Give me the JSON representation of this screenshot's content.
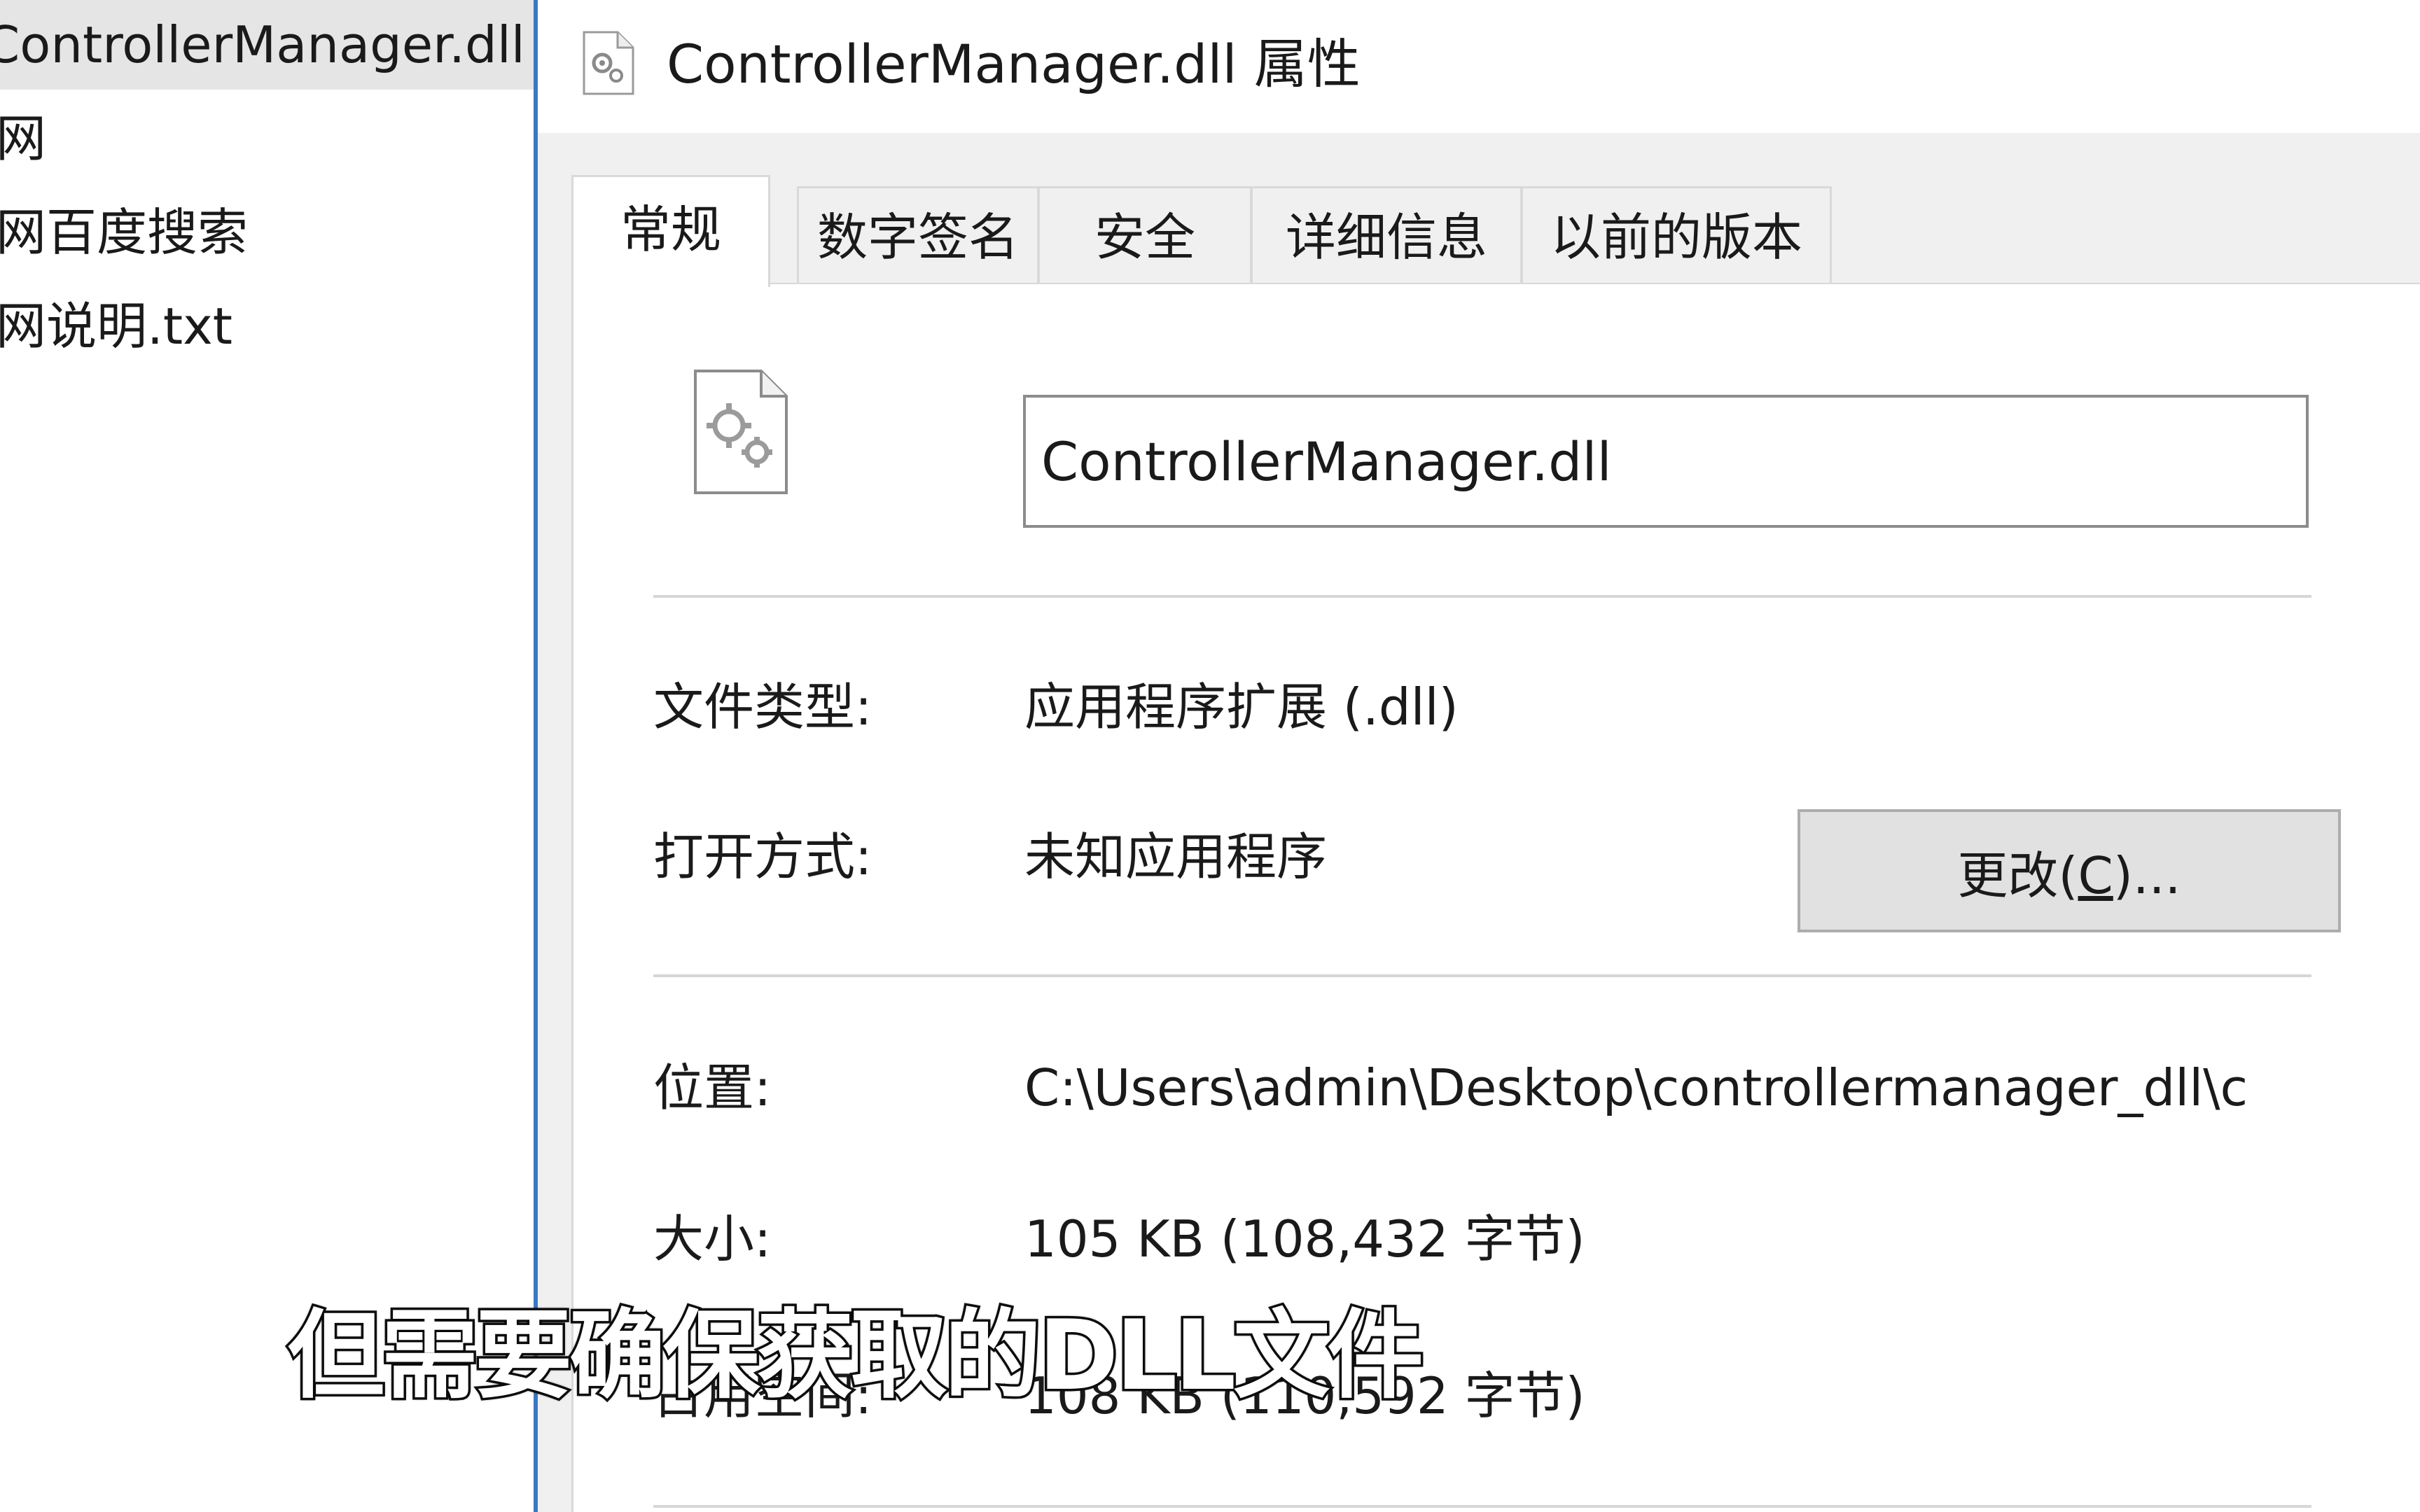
{
  "explorer": {
    "items": [
      {
        "label": "ControllerManager.dll",
        "selected": true
      },
      {
        "label": "网",
        "selected": false
      },
      {
        "label": "网百度搜索",
        "selected": false
      },
      {
        "label": "网说明.txt",
        "selected": false
      }
    ]
  },
  "dialog": {
    "title": "ControllerManager.dll 属性",
    "tabs": [
      "常规",
      "数字签名",
      "安全",
      "详细信息",
      "以前的版本"
    ],
    "active_tab": "常规",
    "file_name": "ControllerManager.dll",
    "props": {
      "file_type_label": "文件类型:",
      "file_type_value": "应用程序扩展 (.dll)",
      "open_with_label": "打开方式:",
      "open_with_value": "未知应用程序",
      "change_button_text": "更改",
      "change_button_mnemonic": "C",
      "change_button_open": "(",
      "change_button_close": ")...",
      "location_label": "位置:",
      "location_value": "C:\\Users\\admin\\Desktop\\controllermanager_dll\\c",
      "size_label": "大小:",
      "size_value": "105 KB (108,432 字节)",
      "size_on_disk_label": "占用空间:",
      "size_on_disk_value": "108 KB (110,592 字节)"
    }
  },
  "subtitle": "但需要确保获取的DLL文件",
  "icons": {
    "title_icon": "dll-file-icon",
    "file_icon": "dll-gear-file-icon"
  },
  "colors": {
    "split_accent": "#3b78c4",
    "selected_row": "#e5e5e5",
    "dialog_bg": "#f0f0f0"
  }
}
